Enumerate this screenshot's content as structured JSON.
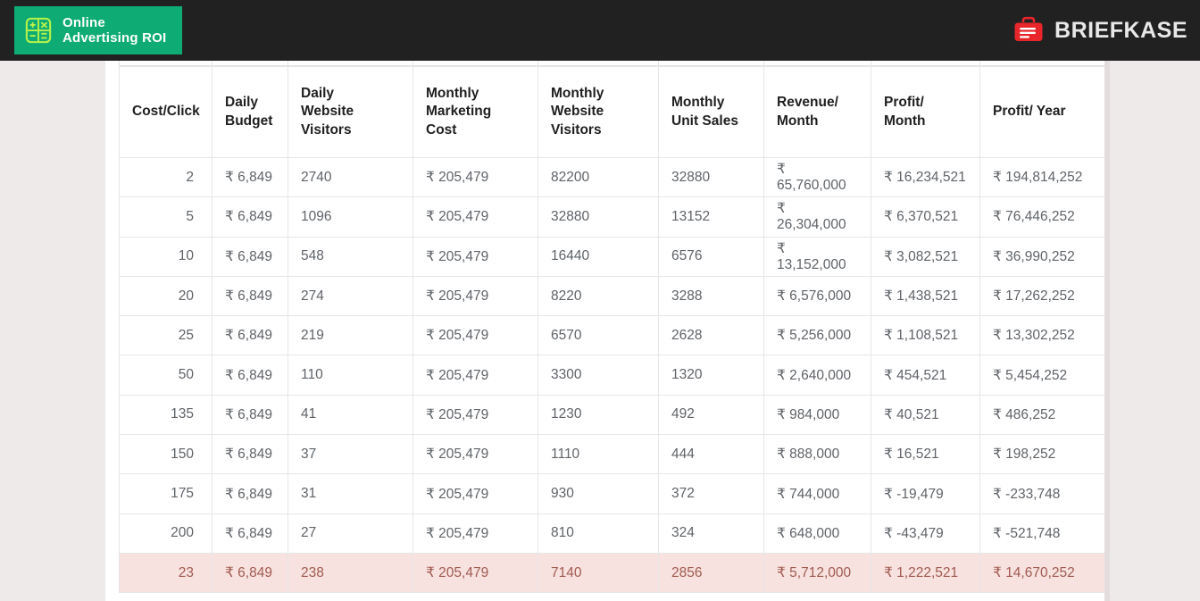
{
  "topbar": {
    "brand_badge": {
      "icon": "calculator-icon",
      "label": "Online\nAdvertising ROI",
      "background": "#0eac74"
    },
    "right_logo": {
      "icon": "briefcase-icon",
      "label": "BRIEFKASE",
      "icon_color": "#e8252a"
    },
    "background": "#212121"
  },
  "table": {
    "headers": [
      "Cost/Click",
      "Daily\nBudget",
      "Daily\nWebsite\nVisitors",
      "Monthly\nMarketing\nCost",
      "Monthly\nWebsite\nVisitors",
      "Monthly\nUnit Sales",
      "Revenue/\nMonth",
      "Profit/\nMonth",
      "Profit/ Year"
    ],
    "rows": [
      {
        "cost_per_click": "2",
        "daily_budget": "₹ 6,849",
        "daily_website_visitors": "2740",
        "monthly_marketing_cost": "₹ 205,479",
        "monthly_website_visitors": "82200",
        "monthly_unit_sales": "32880",
        "revenue_month": "₹ 65,760,000",
        "profit_month": "₹ 16,234,521",
        "profit_year": "₹ 194,814,252",
        "highlight": false
      },
      {
        "cost_per_click": "5",
        "daily_budget": "₹ 6,849",
        "daily_website_visitors": "1096",
        "monthly_marketing_cost": "₹ 205,479",
        "monthly_website_visitors": "32880",
        "monthly_unit_sales": "13152",
        "revenue_month": "₹ 26,304,000",
        "profit_month": "₹ 6,370,521",
        "profit_year": "₹ 76,446,252",
        "highlight": false
      },
      {
        "cost_per_click": "10",
        "daily_budget": "₹ 6,849",
        "daily_website_visitors": "548",
        "monthly_marketing_cost": "₹ 205,479",
        "monthly_website_visitors": "16440",
        "monthly_unit_sales": "6576",
        "revenue_month": "₹ 13,152,000",
        "profit_month": "₹ 3,082,521",
        "profit_year": "₹ 36,990,252",
        "highlight": false
      },
      {
        "cost_per_click": "20",
        "daily_budget": "₹ 6,849",
        "daily_website_visitors": "274",
        "monthly_marketing_cost": "₹ 205,479",
        "monthly_website_visitors": "8220",
        "monthly_unit_sales": "3288",
        "revenue_month": "₹ 6,576,000",
        "profit_month": "₹ 1,438,521",
        "profit_year": "₹ 17,262,252",
        "highlight": false
      },
      {
        "cost_per_click": "25",
        "daily_budget": "₹ 6,849",
        "daily_website_visitors": "219",
        "monthly_marketing_cost": "₹ 205,479",
        "monthly_website_visitors": "6570",
        "monthly_unit_sales": "2628",
        "revenue_month": "₹ 5,256,000",
        "profit_month": "₹ 1,108,521",
        "profit_year": "₹ 13,302,252",
        "highlight": false
      },
      {
        "cost_per_click": "50",
        "daily_budget": "₹ 6,849",
        "daily_website_visitors": "110",
        "monthly_marketing_cost": "₹ 205,479",
        "monthly_website_visitors": "3300",
        "monthly_unit_sales": "1320",
        "revenue_month": "₹ 2,640,000",
        "profit_month": "₹ 454,521",
        "profit_year": "₹ 5,454,252",
        "highlight": false
      },
      {
        "cost_per_click": "135",
        "daily_budget": "₹ 6,849",
        "daily_website_visitors": "41",
        "monthly_marketing_cost": "₹ 205,479",
        "monthly_website_visitors": "1230",
        "monthly_unit_sales": "492",
        "revenue_month": "₹ 984,000",
        "profit_month": "₹ 40,521",
        "profit_year": "₹ 486,252",
        "highlight": false
      },
      {
        "cost_per_click": "150",
        "daily_budget": "₹ 6,849",
        "daily_website_visitors": "37",
        "monthly_marketing_cost": "₹ 205,479",
        "monthly_website_visitors": "1110",
        "monthly_unit_sales": "444",
        "revenue_month": "₹ 888,000",
        "profit_month": "₹ 16,521",
        "profit_year": "₹ 198,252",
        "highlight": false
      },
      {
        "cost_per_click": "175",
        "daily_budget": "₹ 6,849",
        "daily_website_visitors": "31",
        "monthly_marketing_cost": "₹ 205,479",
        "monthly_website_visitors": "930",
        "monthly_unit_sales": "372",
        "revenue_month": "₹ 744,000",
        "profit_month": "₹ -19,479",
        "profit_year": "₹ -233,748",
        "highlight": false
      },
      {
        "cost_per_click": "200",
        "daily_budget": "₹ 6,849",
        "daily_website_visitors": "27",
        "monthly_marketing_cost": "₹ 205,479",
        "monthly_website_visitors": "810",
        "monthly_unit_sales": "324",
        "revenue_month": "₹ 648,000",
        "profit_month": "₹ -43,479",
        "profit_year": "₹ -521,748",
        "highlight": false
      },
      {
        "cost_per_click": "23",
        "daily_budget": "₹ 6,849",
        "daily_website_visitors": "238",
        "monthly_marketing_cost": "₹ 205,479",
        "monthly_website_visitors": "7140",
        "monthly_unit_sales": "2856",
        "revenue_month": "₹ 5,712,000",
        "profit_month": "₹ 1,222,521",
        "profit_year": "₹ 14,670,252",
        "highlight": true
      }
    ],
    "highlight_background": "#f7e2df",
    "highlight_text_color": "#a15a50"
  }
}
